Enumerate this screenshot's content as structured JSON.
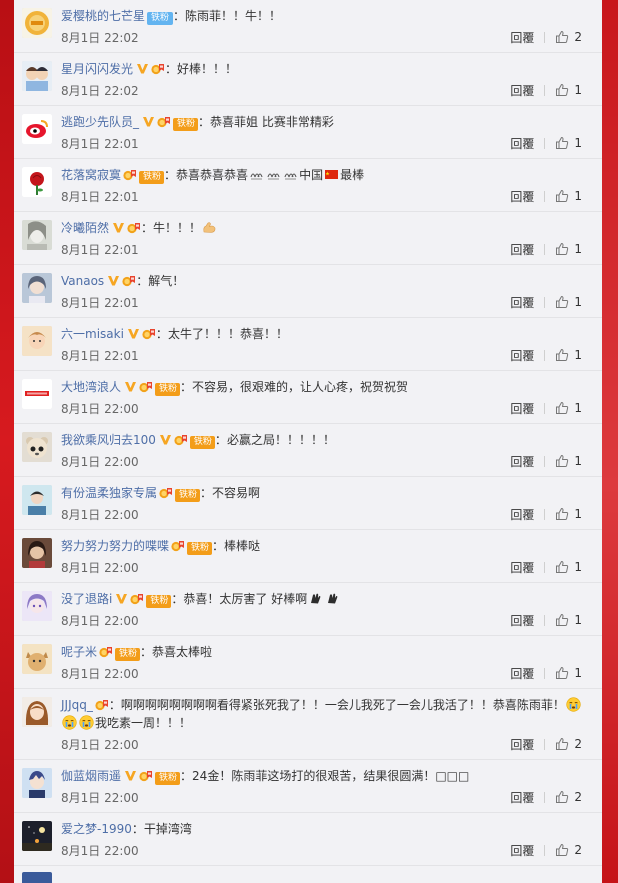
{
  "colors": {
    "username": "#4e6ea7",
    "fan_badge": "#f39d19",
    "verified": "#f6a623",
    "background": "#c7141a",
    "panel": "#f2f2f5"
  },
  "labels": {
    "reply": "回覆",
    "like_icon": "thumbs-up-icon"
  },
  "comments": [
    {
      "username": "爱樱桃的七芒星",
      "verified": false,
      "medal": false,
      "fan_badge": "铁粉",
      "fan_badge_style": "blue",
      "text": "陈雨菲！！牛！！",
      "time": "8月1日 22:02",
      "likes": "2",
      "avatar_icon": "orange-circle-logo-avatar"
    },
    {
      "username": "星月闪闪发光",
      "verified": true,
      "medal": true,
      "fan_badge": "",
      "text": "好棒！！！",
      "time": "8月1日 22:02",
      "likes": "1",
      "avatar_icon": "couple-cartoon-avatar"
    },
    {
      "username": "逃跑少先队员_",
      "verified": true,
      "medal": true,
      "fan_badge": "铁粉",
      "text": "恭喜菲姐 比赛非常精彩",
      "time": "8月1日 22:01",
      "likes": "1",
      "avatar_icon": "weibo-logo-avatar"
    },
    {
      "username": "花落窝寂寞",
      "verified": false,
      "medal": true,
      "fan_badge": "铁粉",
      "text": "恭喜恭喜恭喜",
      "text_suffix": "中国",
      "text_tail": "最棒",
      "inline_emojis": [
        "cheer-emoji",
        "cheer-emoji",
        "cheer-emoji"
      ],
      "flag_emoji": "cn-flag-emoji",
      "time": "8月1日 22:01",
      "likes": "1",
      "avatar_icon": "red-rose-avatar"
    },
    {
      "username": "冷曦陌然",
      "verified": true,
      "medal": true,
      "fan_badge": "",
      "text": "牛！！！",
      "inline_emojis": [
        "muscle-emoji"
      ],
      "time": "8月1日 22:01",
      "likes": "1",
      "avatar_icon": "sketch-portrait-avatar"
    },
    {
      "username": "Vanaos",
      "verified": true,
      "medal": true,
      "fan_badge": "",
      "text": "解气！",
      "time": "8月1日 22:01",
      "likes": "1",
      "avatar_icon": "anime-girl-avatar"
    },
    {
      "username": "六一misaki",
      "verified": true,
      "medal": true,
      "fan_badge": "",
      "text": "太牛了！！！恭喜！！",
      "time": "8月1日 22:01",
      "likes": "1",
      "avatar_icon": "pink-character-avatar"
    },
    {
      "username": "大地湾浪人",
      "verified": true,
      "medal": true,
      "fan_badge": "铁粉",
      "text": "不容易，很艰难的，让人心疼，祝贺祝贺",
      "time": "8月1日 22:00",
      "likes": "1",
      "avatar_icon": "text-logo-avatar"
    },
    {
      "username": "我欲乘风归去100",
      "verified": true,
      "medal": true,
      "fan_badge": "铁粉",
      "text": "必赢之局！！！！！",
      "time": "8月1日 22:00",
      "likes": "1",
      "avatar_icon": "bear-avatar"
    },
    {
      "username": "有份温柔独家专属",
      "verified": false,
      "medal": true,
      "fan_badge": "铁粉",
      "text": "不容易啊",
      "time": "8月1日 22:00",
      "likes": "1",
      "avatar_icon": "boy-portrait-avatar"
    },
    {
      "username": "努力努力努力的喋喋",
      "verified": false,
      "medal": true,
      "fan_badge": "铁粉",
      "text": "棒棒哒",
      "time": "8月1日 22:00",
      "likes": "1",
      "avatar_icon": "dark-portrait-avatar"
    },
    {
      "username": "没了退路i",
      "verified": true,
      "medal": true,
      "fan_badge": "铁粉",
      "text": "恭喜！太厉害了 好棒啊",
      "inline_emojis": [
        "clap-emoji",
        "clap-emoji"
      ],
      "time": "8月1日 22:00",
      "likes": "1",
      "avatar_icon": "purple-anime-avatar"
    },
    {
      "username": "呢子米",
      "verified": false,
      "medal": true,
      "fan_badge": "铁粉",
      "text": "恭喜太棒啦",
      "time": "8月1日 22:00",
      "likes": "1",
      "avatar_icon": "cartoon-cat-avatar"
    },
    {
      "username": "JJJqq_",
      "verified": false,
      "medal": true,
      "fan_badge": "",
      "text": "啊啊啊啊啊啊啊啊看得紧张死我了！！一会儿我死了一会儿我活了！！恭喜陈雨菲！",
      "inline_emojis": [
        "cry-emoji",
        "cry-emoji",
        "cry-emoji"
      ],
      "text_tail": "我吃素一周！！！",
      "time": "8月1日 22:00",
      "likes": "2",
      "avatar_icon": "brown-hair-girl-avatar",
      "tall": true
    },
    {
      "username": "伽蓝烟雨遥",
      "verified": true,
      "medal": true,
      "fan_badge": "铁粉",
      "text": "24金！陈雨菲这场打的很艰苦，结果很圆满！□□□",
      "time": "8月1日 22:00",
      "likes": "2",
      "avatar_icon": "anime-boy-avatar"
    },
    {
      "username": "爱之梦-1990",
      "verified": false,
      "medal": false,
      "fan_badge": "",
      "text": "干掉湾湾",
      "time": "8月1日 22:00",
      "likes": "2",
      "avatar_icon": "night-sky-avatar"
    }
  ]
}
